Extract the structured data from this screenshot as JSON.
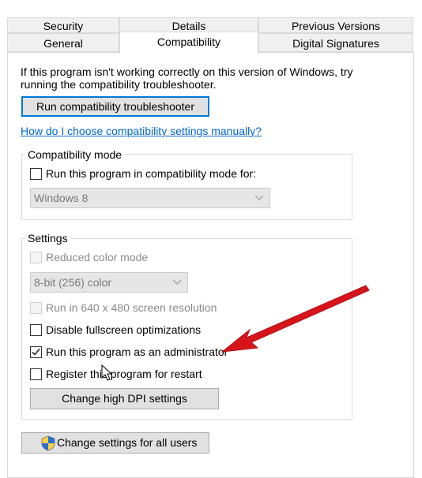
{
  "tabs": {
    "row1": [
      "Security",
      "Details",
      "Previous Versions"
    ],
    "row2": [
      "General",
      "Compatibility",
      "Digital Signatures"
    ],
    "active": "Compatibility"
  },
  "intro": {
    "line1": "If this program isn't working correctly on this version of Windows, try",
    "line2": "running the compatibility troubleshooter."
  },
  "troubleshooter_button": "Run compatibility troubleshooter",
  "help_link": "How do I choose compatibility settings manually?",
  "compat_mode": {
    "legend": "Compatibility mode",
    "checkbox_label": "Run this program in compatibility mode for:",
    "checked": false,
    "select_value": "Windows 8"
  },
  "settings": {
    "legend": "Settings",
    "reduced_color": {
      "label": "Reduced color mode",
      "checked": false,
      "enabled": false
    },
    "color_select_value": "8-bit (256) color",
    "res_640": {
      "label": "Run in 640 x 480 screen resolution",
      "checked": false,
      "enabled": false
    },
    "disable_fullscreen": {
      "label": "Disable fullscreen optimizations",
      "checked": false,
      "enabled": true
    },
    "run_as_admin": {
      "label": "Run this program as an administrator",
      "checked": true,
      "enabled": true
    },
    "register_restart": {
      "label": "Register this program for restart",
      "checked": false,
      "enabled": true
    },
    "dpi_button": "Change high DPI settings"
  },
  "all_users_button": "Change settings for all users",
  "colors": {
    "accent": "#0078d7",
    "link": "#0066cc",
    "arrow": "#d8141b"
  }
}
